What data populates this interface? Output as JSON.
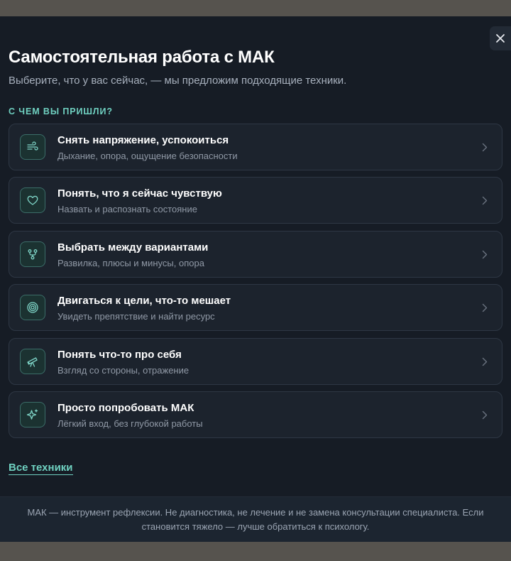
{
  "dialog": {
    "title": "Самостоятельная работа с МАК",
    "subtitle": "Выберите, что у вас сейчас, — мы предложим подходящие техники.",
    "section_label": "С ЧЕМ ВЫ ПРИШЛИ?",
    "close_icon": "close-icon",
    "options": [
      {
        "title": "Снять напряжение, успокоиться",
        "description": "Дыхание, опора, ощущение безопасности",
        "icon": "wind-icon"
      },
      {
        "title": "Понять, что я сейчас чувствую",
        "description": "Назвать и распознать состояние",
        "icon": "heart-icon"
      },
      {
        "title": "Выбрать между вариантами",
        "description": "Развилка, плюсы и минусы, опора",
        "icon": "fork-icon"
      },
      {
        "title": "Двигаться к цели, что-то мешает",
        "description": "Увидеть препятствие и найти ресурс",
        "icon": "target-icon"
      },
      {
        "title": "Понять что-то про себя",
        "description": "Взгляд со стороны, отражение",
        "icon": "telescope-icon"
      },
      {
        "title": "Просто попробовать МАК",
        "description": "Лёгкий вход, без глубокой работы",
        "icon": "sparkles-icon"
      }
    ],
    "all_techniques_link": "Все техники",
    "footer_note": "МАК — инструмент рефлексии. Не диагностика, не лечение и не замена консультации специалиста. Если становится тяжело — лучше обратиться к психологу."
  },
  "colors": {
    "background": "#161c25",
    "accent": "#6fd0c0",
    "card": "#1c232d",
    "card_border": "#2e3744",
    "text_primary": "#ffffff",
    "text_secondary": "#9099a6"
  }
}
